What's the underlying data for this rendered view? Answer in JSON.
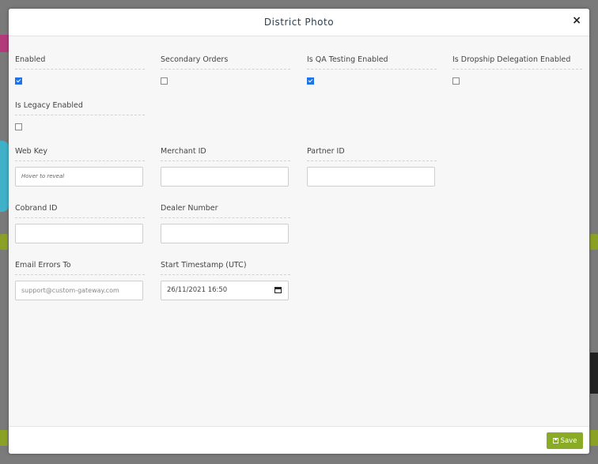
{
  "modal": {
    "title": "District Photo",
    "close_icon": "close-icon"
  },
  "checkboxes": [
    {
      "label": "Enabled",
      "checked": true
    },
    {
      "label": "Secondary Orders",
      "checked": false
    },
    {
      "label": "Is QA Testing Enabled",
      "checked": true
    },
    {
      "label": "Is Dropship Delegation Enabled",
      "checked": false
    },
    {
      "label": "Is Legacy Enabled",
      "checked": false
    }
  ],
  "fields": {
    "web_key": {
      "label": "Web Key",
      "placeholder": "Hover to reveal",
      "value": ""
    },
    "merchant_id": {
      "label": "Merchant ID",
      "value": ""
    },
    "partner_id": {
      "label": "Partner ID",
      "value": ""
    },
    "cobrand_id": {
      "label": "Cobrand ID",
      "value": ""
    },
    "dealer_number": {
      "label": "Dealer Number",
      "value": ""
    },
    "email_errors_to": {
      "label": "Email Errors To",
      "placeholder": "support@custom-gateway.com",
      "value": ""
    },
    "start_timestamp": {
      "label": "Start Timestamp (UTC)",
      "value": "26/11/2021 16:50"
    }
  },
  "footer": {
    "save_label": "Save"
  },
  "colors": {
    "save_button": "#8aab25",
    "checkbox_checked": "#1d73e8"
  }
}
